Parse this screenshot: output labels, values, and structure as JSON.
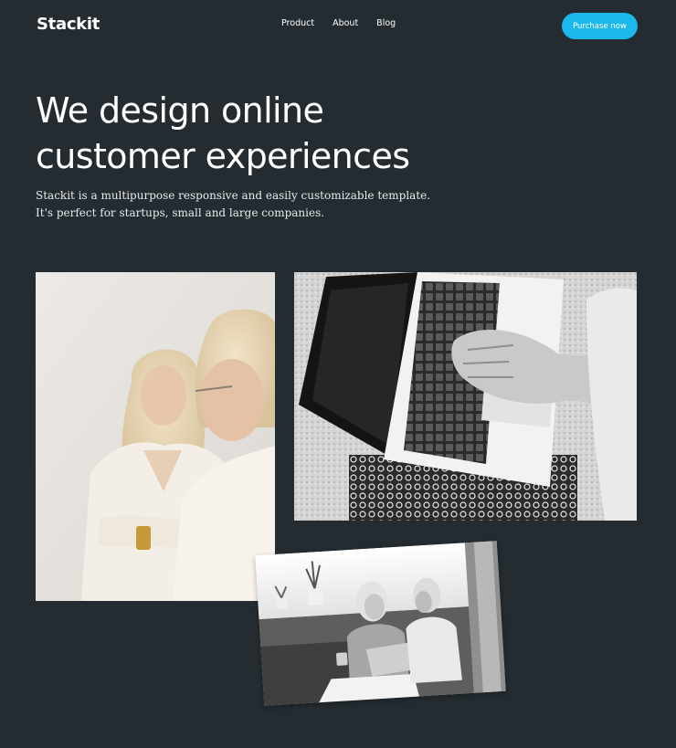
{
  "brand": "Stackit",
  "nav": {
    "items": [
      "Product",
      "About",
      "Blog"
    ],
    "cta": "Purchase now"
  },
  "hero": {
    "title_line1": "We design online",
    "title_line2": "customer experiences",
    "subtitle_line1": "Stackit is a multipurpose responsive and easily customizable template.",
    "subtitle_line2": "It's perfect for startups, small and large companies."
  },
  "colors": {
    "background": "#242c31",
    "accent": "#1cb7ec",
    "text": "#ffffff"
  }
}
